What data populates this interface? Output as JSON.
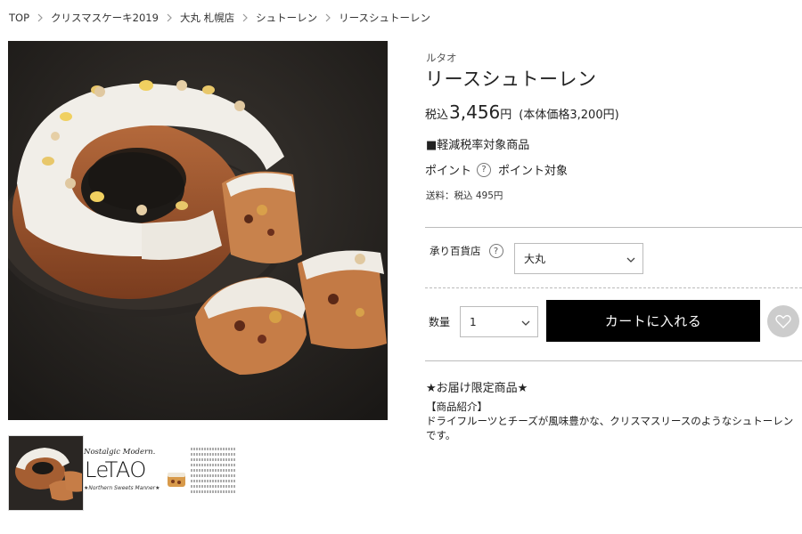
{
  "breadcrumb": [
    {
      "label": "TOP"
    },
    {
      "label": "クリスマスケーキ2019"
    },
    {
      "label": "大丸 札幌店"
    },
    {
      "label": "シュトーレン"
    },
    {
      "label": "リースシュトーレン"
    }
  ],
  "product": {
    "brand": "ルタオ",
    "title": "リースシュトーレン",
    "tax_label": "税込",
    "price": "3,456",
    "yen": "円",
    "base_price": "(本体価格3,200円)",
    "reduced_tax": "■軽減税率対象商品",
    "point_label": "ポイント",
    "point_value": "ポイント対象",
    "shipping": "送料：税込 495円"
  },
  "store": {
    "label": "承り百貨店",
    "selected": "大丸"
  },
  "quantity": {
    "label": "数量",
    "selected": "1"
  },
  "cart_button": "カートに入れる",
  "description": {
    "limited": "★お届け限定商品★",
    "heading": "【商品紹介】",
    "body": "ドライフルーツとチーズが風味豊かな、クリスマスリースのようなシュトーレンです。"
  },
  "thumbnail_2": {
    "tagline": "Nostalgic Modern.",
    "logo": "LeTAO",
    "subtitle": "★Northern Sweets Manner★"
  },
  "icons": {
    "breadcrumb_separator": "chevron-right-icon",
    "help": "question-circle-icon",
    "select_arrow": "chevron-down-icon",
    "favorite": "heart-icon"
  },
  "colors": {
    "cart_button_bg": "#000000",
    "favorite_bg": "#cccccc",
    "divider": "#bbbbbb"
  }
}
